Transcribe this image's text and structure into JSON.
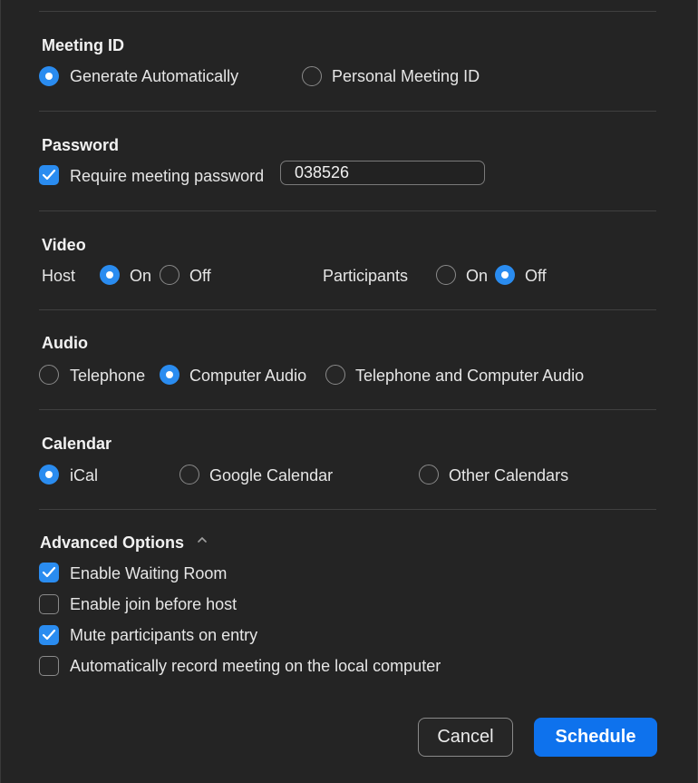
{
  "meeting_id": {
    "heading": "Meeting ID",
    "options": [
      {
        "label": "Generate Automatically",
        "selected": true
      },
      {
        "label": "Personal Meeting ID",
        "selected": false
      }
    ]
  },
  "password": {
    "heading": "Password",
    "require_label": "Require meeting password",
    "require_checked": true,
    "value": "038526"
  },
  "video": {
    "heading": "Video",
    "host_label": "Host",
    "participants_label": "Participants",
    "host_on_label": "On",
    "host_off_label": "Off",
    "part_on_label": "On",
    "part_off_label": "Off",
    "host_selected": "On",
    "participants_selected": "Off"
  },
  "audio": {
    "heading": "Audio",
    "options": [
      {
        "label": "Telephone",
        "selected": false
      },
      {
        "label": "Computer Audio",
        "selected": true
      },
      {
        "label": "Telephone and Computer Audio",
        "selected": false
      }
    ]
  },
  "calendar": {
    "heading": "Calendar",
    "options": [
      {
        "label": "iCal",
        "selected": true
      },
      {
        "label": "Google Calendar",
        "selected": false
      },
      {
        "label": "Other Calendars",
        "selected": false
      }
    ]
  },
  "advanced": {
    "heading": "Advanced Options",
    "expanded": true,
    "options": [
      {
        "label": "Enable Waiting Room",
        "checked": true
      },
      {
        "label": "Enable join before host",
        "checked": false
      },
      {
        "label": "Mute participants on entry",
        "checked": true
      },
      {
        "label": "Automatically record meeting on the local computer",
        "checked": false
      }
    ]
  },
  "buttons": {
    "cancel": "Cancel",
    "schedule": "Schedule"
  },
  "colors": {
    "accent": "#2a8cf0",
    "primary_button": "#0e72ed",
    "background": "#242424"
  }
}
